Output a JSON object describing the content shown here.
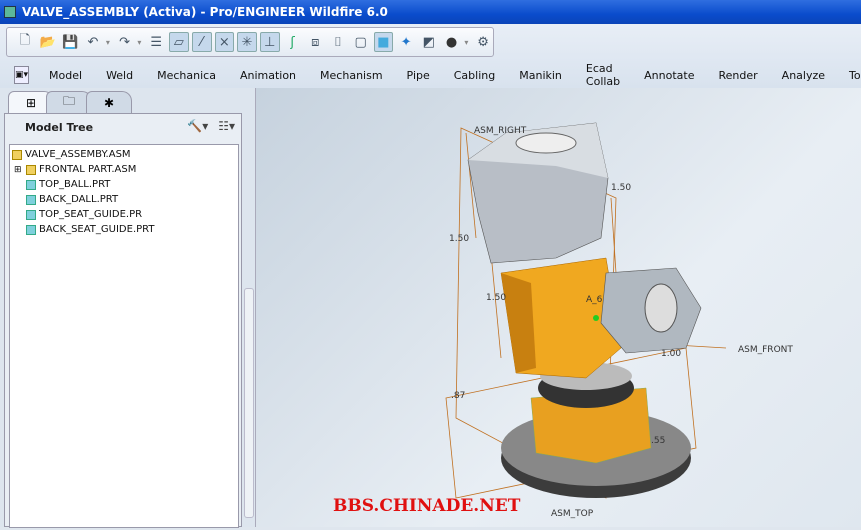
{
  "window": {
    "title": "VALVE_ASSEMBLY (Activa) - Pro/ENGINEER Wildfire 6.0"
  },
  "toolbar": [
    "new",
    "open",
    "save",
    "undo",
    "redo",
    "regenerate",
    "datum-planes",
    "datum-axes",
    "datum-points",
    "csys",
    "spin-center",
    "wireframe",
    "hidden-line",
    "no-hidden",
    "shading",
    "orient",
    "view-manager",
    "appearance",
    "model-tree-settings"
  ],
  "menu": [
    "Model",
    "Weld",
    "Mechanica",
    "Animation",
    "Mechanism",
    "Pipe",
    "Cabling",
    "Manikin",
    "Ecad Collab",
    "Annotate",
    "Render",
    "Analyze",
    "Tools"
  ],
  "panel": {
    "title": "Model Tree"
  },
  "tree": [
    {
      "label": "VALVE_ASSEMBY.ASM",
      "type": "asm",
      "level": 0
    },
    {
      "label": "FRONTAL PART.ASM",
      "type": "asm",
      "level": 1,
      "expandable": true
    },
    {
      "label": "TOP_BALL.PRT",
      "type": "prt",
      "level": 1
    },
    {
      "label": "BACK_DALL.PRT",
      "type": "prt",
      "level": 1
    },
    {
      "label": "TOP_SEAT_GUIDE.PR",
      "type": "prt",
      "level": 1
    },
    {
      "label": "BACK_SEAT_GUIDE.PRT",
      "type": "prt",
      "level": 1
    }
  ],
  "viewport": {
    "datums": [
      "ASM_RIGHT",
      "ASM_FRONT",
      "ASM_TOP"
    ],
    "dims": [
      "1.50",
      "1.50",
      "1.50",
      "1.00",
      ".87",
      ".55",
      "A_6"
    ]
  },
  "watermark": "BBS.CHINADE.NET"
}
